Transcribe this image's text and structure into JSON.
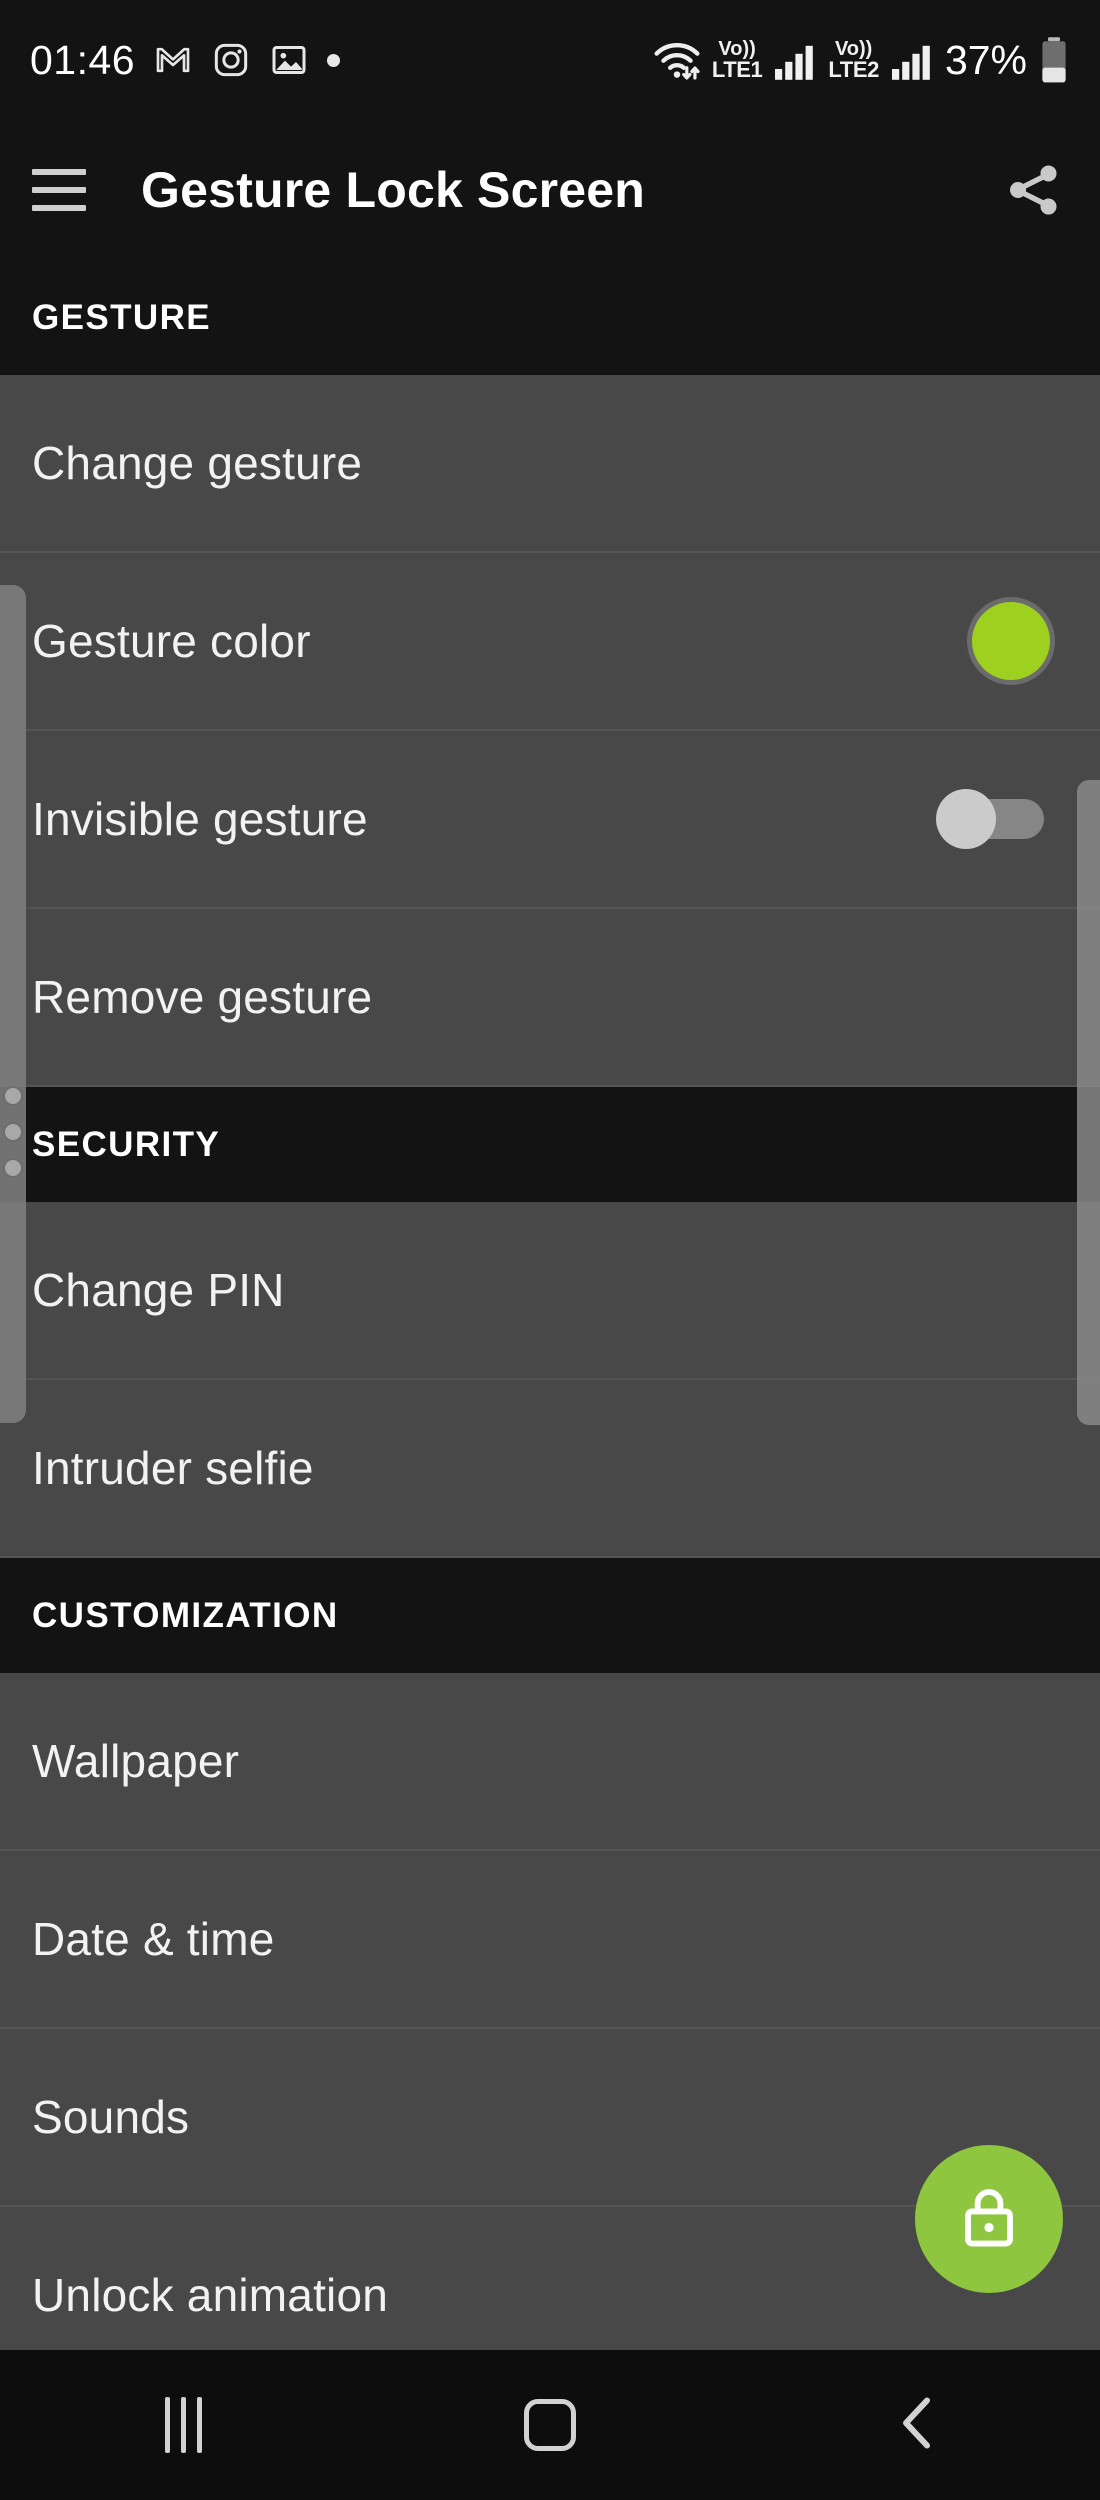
{
  "status_bar": {
    "time": "01:46",
    "left_icons": [
      "gmail-icon",
      "instagram-icon",
      "gallery-icon",
      "dot-indicator"
    ],
    "wifi": "wifi-icon",
    "sim1_label": "LTE1",
    "sim1_volte": "Vo))",
    "sim2_label": "LTE2",
    "sim2_volte": "Vo))",
    "battery_percent": "37%",
    "battery_level": 37
  },
  "toolbar": {
    "menu_icon": "hamburger-menu-icon",
    "title": "Gesture Lock Screen",
    "share_icon": "share-icon"
  },
  "sections": [
    {
      "header": "GESTURE",
      "rows": [
        {
          "label": "Change gesture",
          "accessory": "none"
        },
        {
          "label": "Gesture color",
          "accessory": "color-swatch",
          "color": "#9ed01f"
        },
        {
          "label": "Invisible gesture",
          "accessory": "switch",
          "switch_on": false
        },
        {
          "label": "Remove gesture",
          "accessory": "none"
        }
      ]
    },
    {
      "header": "SECURITY",
      "rows": [
        {
          "label": "Change PIN",
          "accessory": "none"
        },
        {
          "label": "Intruder selfie",
          "accessory": "none"
        }
      ]
    },
    {
      "header": "CUSTOMIZATION",
      "rows": [
        {
          "label": "Wallpaper",
          "accessory": "none"
        },
        {
          "label": "Date & time",
          "accessory": "none"
        },
        {
          "label": "Sounds",
          "accessory": "none"
        },
        {
          "label": "Unlock animation",
          "accessory": "none"
        }
      ]
    }
  ],
  "fab": {
    "icon": "lock-icon",
    "color": "#8ec63f"
  },
  "nav_bar": {
    "recents": "recents-icon",
    "home": "home-icon",
    "back": "back-icon"
  },
  "theme": {
    "background": "#131313",
    "row_background": "#484848",
    "accent": "#9ed01f",
    "text": "#f2f2f2"
  }
}
